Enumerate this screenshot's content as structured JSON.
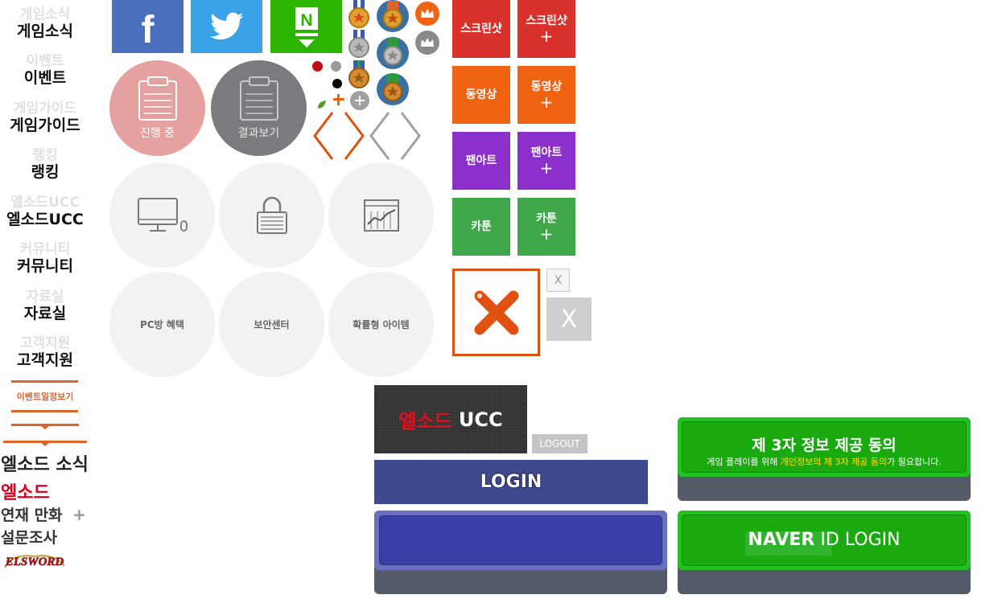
{
  "nav": {
    "items": [
      {
        "ghost": "게임소식",
        "label": "게임소식"
      },
      {
        "ghost": "이벤트",
        "label": "이벤트"
      },
      {
        "ghost": "게임가이드",
        "label": "게임가이드"
      },
      {
        "ghost": "랭킹",
        "label": "랭킹"
      },
      {
        "ghost": "엘소드UCC",
        "label": "엘소드UCC"
      },
      {
        "ghost": "커뮤니티",
        "label": "커뮤니티"
      },
      {
        "ghost": "자료실",
        "label": "자료실"
      },
      {
        "ghost": "고객지원",
        "label": "고객지원"
      }
    ],
    "event_schedule": "이벤트일정보기"
  },
  "side_menu": {
    "news": "엘소드 소식",
    "elsword": "엘소드",
    "comic": "연재 만화",
    "comic_plus": "+",
    "survey": "설문조사",
    "logo_text": "ELSWORD"
  },
  "social": {
    "facebook": "f",
    "naver": "N"
  },
  "status": {
    "in_progress": "진행 중",
    "results": "결과보기"
  },
  "features": {
    "pcbang": "PC방 혜택",
    "security": "보안센터",
    "probability": "확률형 아이템"
  },
  "tiles": {
    "screenshot": "스크린샷",
    "video": "동영상",
    "fanart": "팬아트",
    "cartoon": "카툰",
    "plus": "+"
  },
  "close": {
    "small": "X",
    "large": "X"
  },
  "ucc": {
    "brand": "엘소드",
    "suffix": " UCC"
  },
  "buttons": {
    "logout": "LOGOUT",
    "login": "LOGIN",
    "naver_brand": "NAVER",
    "naver_suffix": " ID LOGIN"
  },
  "consent": {
    "title": "제 3자 정보 제공 동의",
    "prefix": "게임 플레이를 위해 ",
    "highlight": "개인정보의 제 3자 제공 동의",
    "suffix": "가 필요합니다."
  },
  "colors": {
    "facebook": "#4a6fbf",
    "twitter": "#3aa3e8",
    "naver": "#2db400",
    "red_tile": "#d9312b",
    "orange_tile": "#ef6312",
    "purple_tile": "#8c30cc",
    "green_tile": "#3fa64a",
    "login": "#3f4a8e",
    "accent": "#e0632a"
  }
}
